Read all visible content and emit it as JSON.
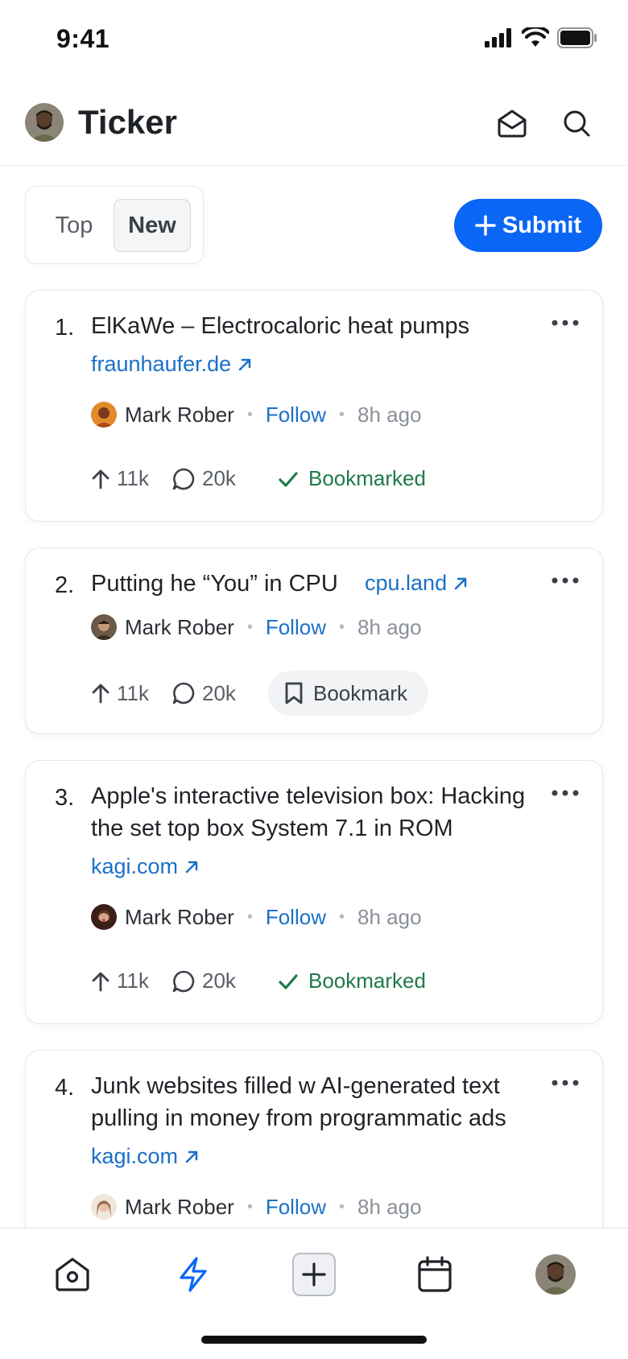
{
  "status_bar": {
    "time": "9:41"
  },
  "header": {
    "title": "Ticker"
  },
  "tabs": {
    "top": "Top",
    "new": "New",
    "active": "New"
  },
  "submit_button": "Submit",
  "colors": {
    "accent": "#0a66f5",
    "link": "#1b70c8",
    "bookmarked": "#1f7a4a"
  },
  "posts": [
    {
      "num": "1.",
      "title": "ElKaWe – Electrocaloric heat pumps",
      "domain": "fraunhaufer.de",
      "author": "Mark Rober",
      "follow": "Follow",
      "time": "8h ago",
      "upvotes": "11k",
      "comments": "20k",
      "bookmark_label": "Bookmarked",
      "bookmarked": true
    },
    {
      "num": "2.",
      "title": "Putting he “You” in CPU",
      "domain": "cpu.land",
      "author": "Mark Rober",
      "follow": "Follow",
      "time": "8h ago",
      "upvotes": "11k",
      "comments": "20k",
      "bookmark_label": "Bookmark",
      "bookmarked": false
    },
    {
      "num": "3.",
      "title_lines": [
        "Apple's interactive television box: Hacking",
        "the set top box System 7.1 in ROM"
      ],
      "domain": "kagi.com",
      "author": "Mark Rober",
      "follow": "Follow",
      "time": "8h ago",
      "upvotes": "11k",
      "comments": "20k",
      "bookmark_label": "Bookmarked",
      "bookmarked": true
    },
    {
      "num": "4.",
      "title_lines": [
        "Junk websites filled w AI-generated text",
        "pulling in money from programmatic ads"
      ],
      "domain": "kagi.com",
      "author": "Mark Rober",
      "follow": "Follow",
      "time": "8h ago"
    }
  ],
  "tabbar": {
    "icons": [
      "home-icon",
      "lightning-icon",
      "plus-square-icon",
      "calendar-icon",
      "profile-avatar"
    ],
    "active": "lightning-icon"
  }
}
